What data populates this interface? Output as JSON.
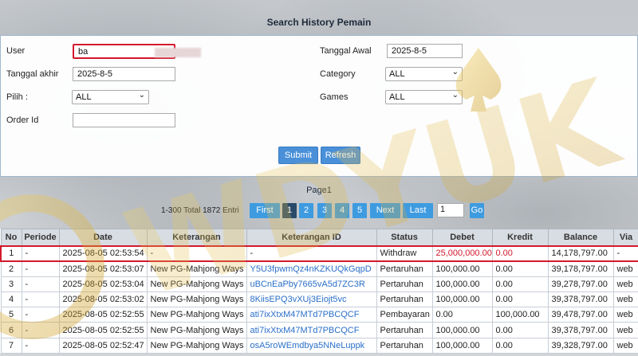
{
  "page": {
    "title": "Search History Pemain"
  },
  "form": {
    "user_label": "User",
    "user_value": "ba",
    "tanggal_awal_label": "Tanggal Awal",
    "tanggal_awal_value": "2025-8-5",
    "tanggal_akhir_label": "Tanggal akhir",
    "tanggal_akhir_value": "2025-8-5",
    "category_label": "Category",
    "category_value": "ALL",
    "pilih_label": "Pilih :",
    "pilih_value": "ALL",
    "games_label": "Games",
    "games_value": "ALL",
    "order_id_label": "Order Id",
    "order_id_value": "",
    "submit_label": "Submit",
    "refresh_label": "Refresh"
  },
  "pagination": {
    "page_title": "Page1",
    "summary": "1-300 Total 1872 Entri",
    "first_label": "First",
    "pages": [
      "1",
      "2",
      "3",
      "4",
      "5"
    ],
    "active_page": "1",
    "next_label": "Next",
    "last_label": "Last",
    "goto_value": "1",
    "go_label": "Go"
  },
  "table": {
    "headers": [
      "No",
      "Periode",
      "Date",
      "Keterangan",
      "Keterangan ID",
      "Status",
      "Debet",
      "Kredit",
      "Balance",
      "Via"
    ],
    "rows": [
      [
        "1",
        "-",
        "2025-08-05 02:53:54",
        "-",
        "-",
        "Withdraw",
        "25,000,000.00",
        "0.00",
        "14,178,797.00",
        "-"
      ],
      [
        "2",
        "-",
        "2025-08-05 02:53:07",
        "New PG-Mahjong Ways",
        "Y5U3fpwmQz4nKZKUQkGqpD",
        "Pertaruhan",
        "100,000.00",
        "0.00",
        "39,178,797.00",
        "web"
      ],
      [
        "3",
        "-",
        "2025-08-05 02:53:04",
        "New PG-Mahjong Ways",
        "uBCnEaPby7665vA5d7ZC3R",
        "Pertaruhan",
        "100,000.00",
        "0.00",
        "39,278,797.00",
        "web"
      ],
      [
        "4",
        "-",
        "2025-08-05 02:53:02",
        "New PG-Mahjong Ways",
        "8KiisEPQ3vXUj3Eiojt5vc",
        "Pertaruhan",
        "100,000.00",
        "0.00",
        "39,378,797.00",
        "web"
      ],
      [
        "5",
        "-",
        "2025-08-05 02:52:55",
        "New PG-Mahjong Ways",
        "ati7ixXtxM47MTd7PBCQCF",
        "Pembayaran",
        "0.00",
        "100,000.00",
        "39,478,797.00",
        "web"
      ],
      [
        "6",
        "-",
        "2025-08-05 02:52:55",
        "New PG-Mahjong Ways",
        "ati7ixXtxM47MTd7PBCQCF",
        "Pertaruhan",
        "100,000.00",
        "0.00",
        "39,378,797.00",
        "web"
      ],
      [
        "7",
        "-",
        "2025-08-05 02:52:47",
        "New PG-Mahjong Ways",
        "osA5roWEmdbya5NNeLuppk",
        "Pertaruhan",
        "100,000.00",
        "0.00",
        "39,328,797.00",
        "web"
      ]
    ]
  },
  "watermark": {
    "text": "WDYUK"
  },
  "colors": {
    "accent": "#4a90d9",
    "highlight": "#d3192b",
    "link": "#2a6fc9"
  }
}
